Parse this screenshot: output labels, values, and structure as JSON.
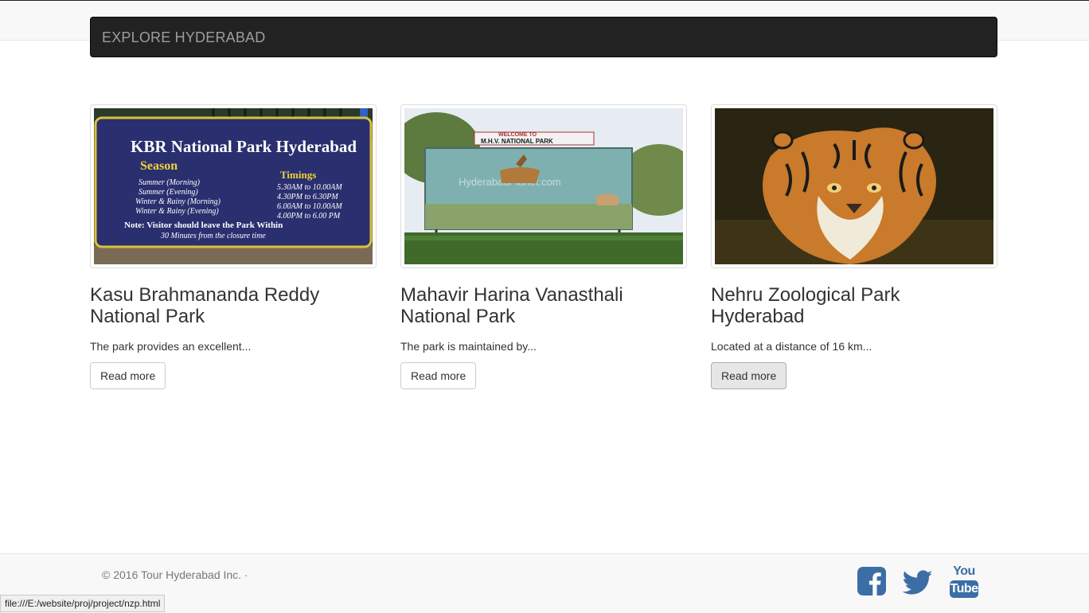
{
  "navbar": {
    "brand": "EXPLORE HYDERABAD"
  },
  "cards": [
    {
      "title": "Kasu Brahmananda Reddy National Park",
      "excerpt": "The park provides an excellent...",
      "button": "Read more",
      "sign": {
        "heading": "KBR National Park Hyderabad",
        "season": "Season",
        "timings": "Timings",
        "rows": [
          [
            "Summer (Morning)",
            "5.30AM to 10.00AM"
          ],
          [
            "Summer (Evening)",
            "4.30PM to 6.30PM"
          ],
          [
            "Winter & Rainy (Morning)",
            "6.00AM to 10.00AM"
          ],
          [
            "Winter & Rainy (Evening)",
            "4.00PM to 6.00 PM"
          ]
        ],
        "note": "Note: Visitor should leave the Park Within",
        "note2": "30 Minutes from the closure time"
      }
    },
    {
      "title": "Mahavir Harina Vanasthali National Park",
      "excerpt": "The park is maintained by...",
      "button": "Read more",
      "sign": {
        "welcome": "WELCOME TO",
        "name": "M.H.V. NATIONAL PARK",
        "watermark": "HyderabadPlanet.com"
      }
    },
    {
      "title": "Nehru Zoological Park Hyderabad",
      "excerpt": "Located at a distance of 16 km...",
      "button": "Read more"
    }
  ],
  "footer": {
    "copyright": "© 2016 Tour Hyderabad Inc. ·",
    "social": {
      "youtube_top": "You",
      "youtube_bottom": "Tube",
      "color": "#3b6ea5"
    }
  },
  "status_bar": {
    "url": "file:///E:/website/proj/project/nzp.html"
  }
}
